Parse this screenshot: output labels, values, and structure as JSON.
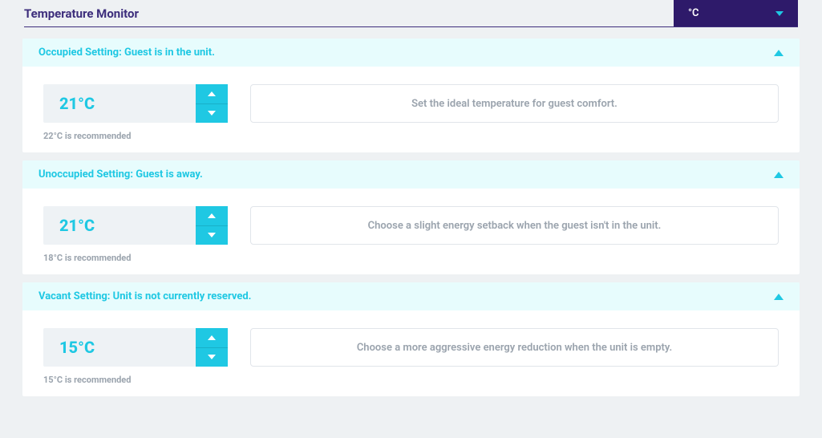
{
  "header": {
    "title": "Temperature Monitor",
    "unit_select_label": "°C"
  },
  "sections": [
    {
      "id": "occupied",
      "title": "Occupied Setting: Guest is in the unit.",
      "value": "21°C",
      "recommend": "22°C is recommended",
      "description": "Set the ideal temperature for guest comfort."
    },
    {
      "id": "unoccupied",
      "title": "Unoccupied Setting: Guest is away.",
      "value": "21°C",
      "recommend": "18°C is recommended",
      "description": "Choose a slight energy setback when the guest isn't in the unit."
    },
    {
      "id": "vacant",
      "title": "Vacant Setting: Unit is not currently reserved.",
      "value": "15°C",
      "recommend": "15°C is recommended",
      "description": "Choose a more aggressive energy reduction when the unit is empty."
    }
  ]
}
